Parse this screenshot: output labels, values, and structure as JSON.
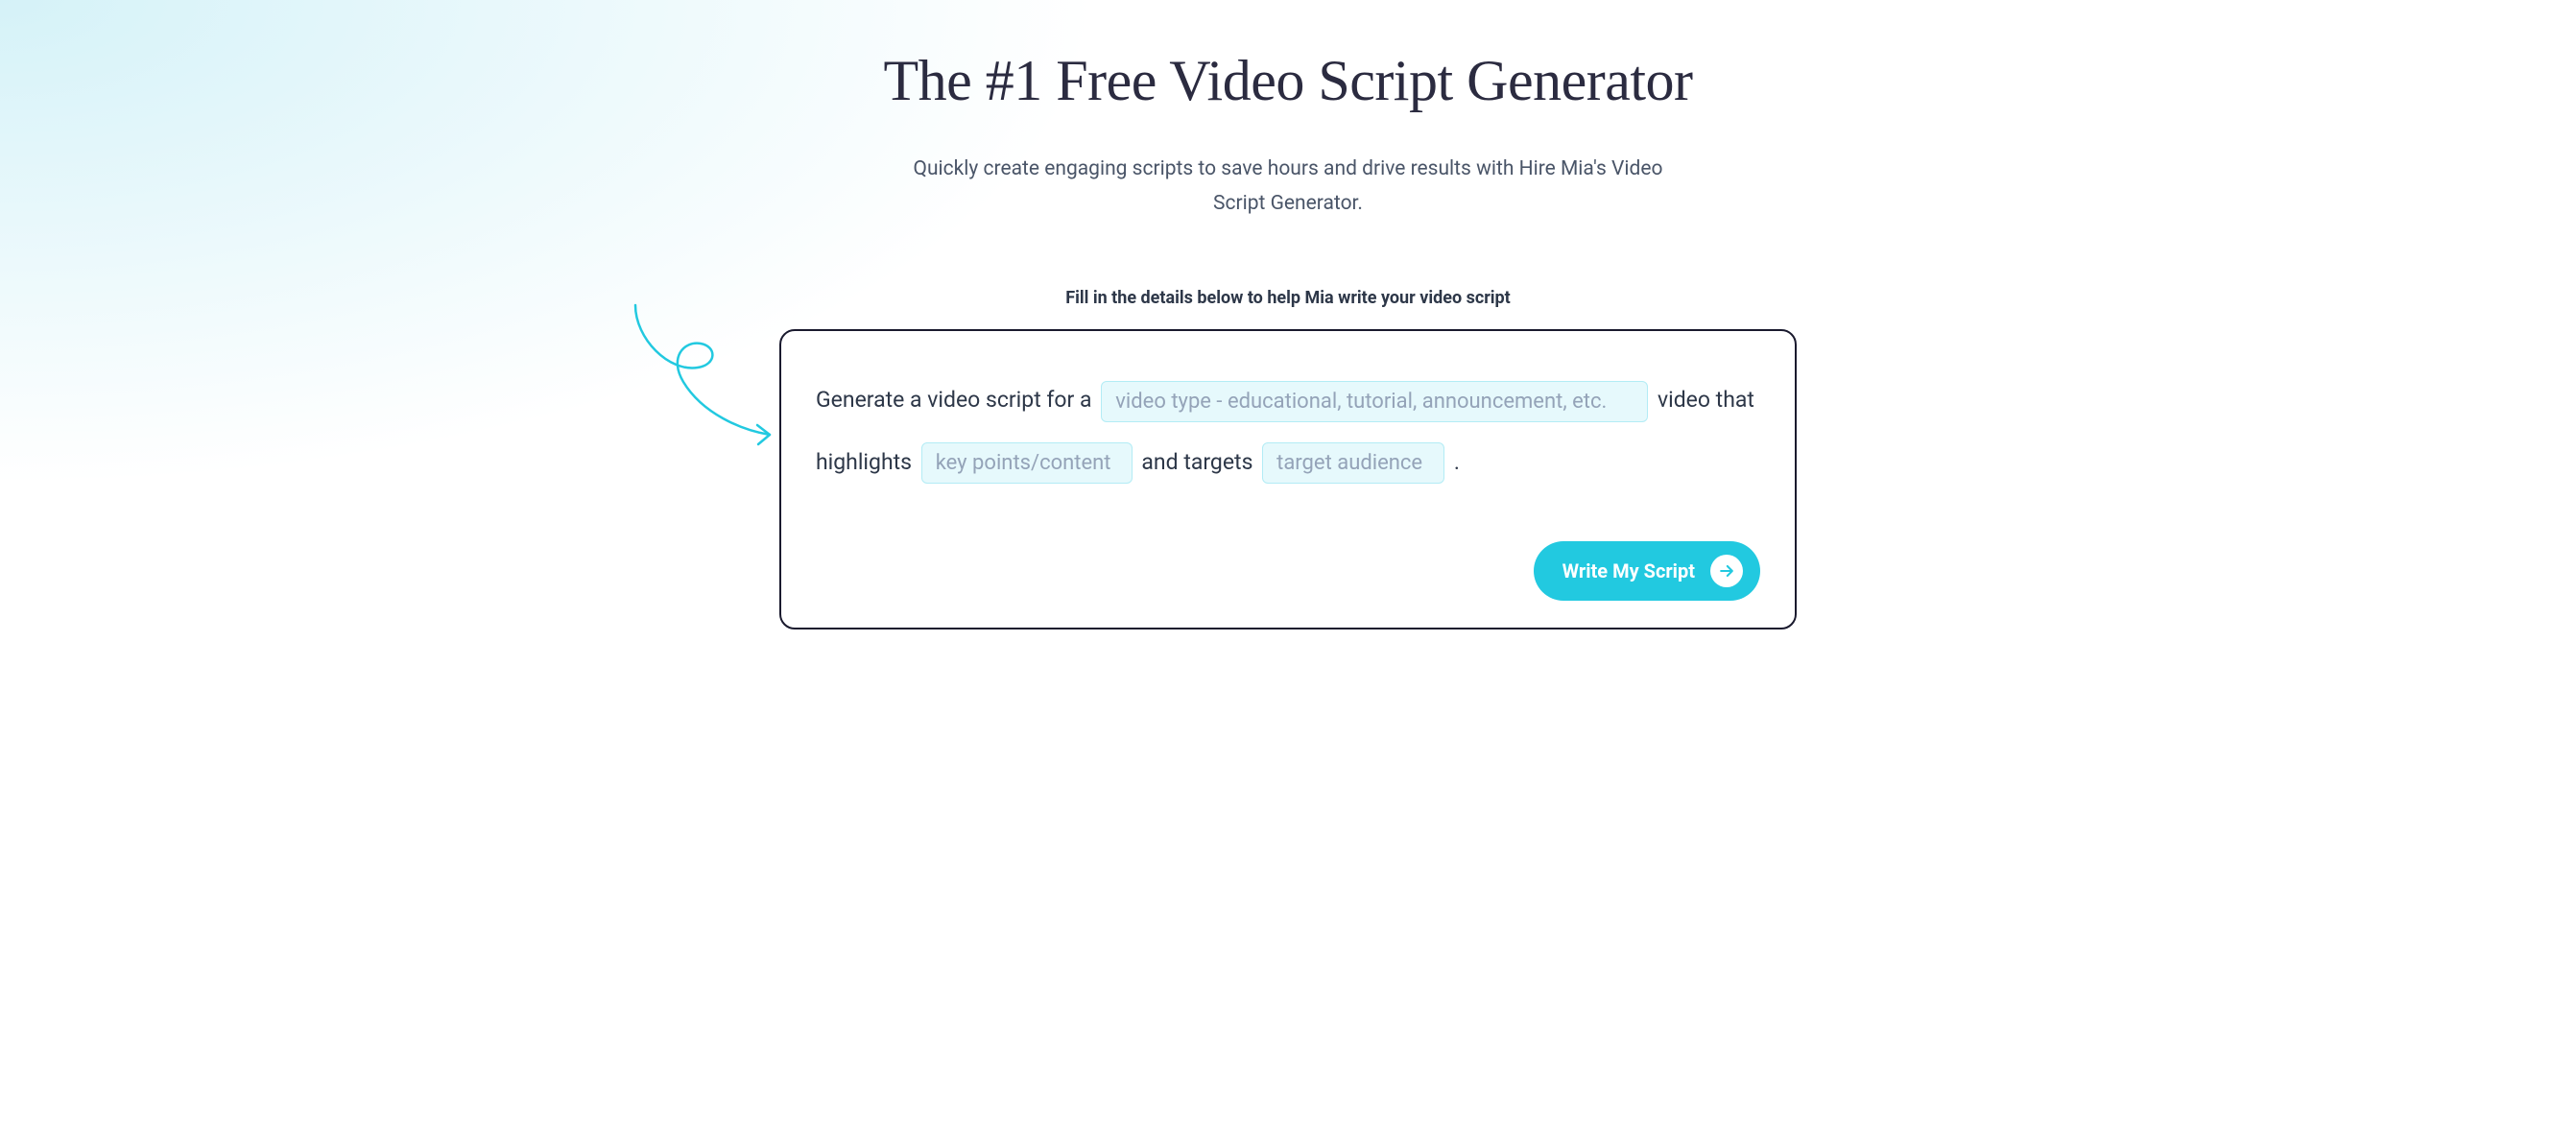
{
  "header": {
    "title": "The #1 Free Video Script Generator",
    "subtitle": "Quickly create engaging scripts to save hours and drive results with Hire Mia's Video Script Generator."
  },
  "form": {
    "instruction": "Fill in the details below to help Mia write your video script",
    "prompt_parts": {
      "prefix": "Generate a video script for a ",
      "after_video_type": " video that highlights ",
      "after_key_points": " and targets ",
      "suffix": " ."
    },
    "inputs": {
      "video_type": {
        "placeholder": "video type - educational, tutorial, announcement, etc.",
        "value": ""
      },
      "key_points": {
        "placeholder": "key points/content",
        "value": ""
      },
      "audience": {
        "placeholder": "target audience",
        "value": ""
      }
    },
    "submit_label": "Write My Script"
  },
  "colors": {
    "accent": "#22c9e0",
    "card_border": "#1a1a2e",
    "input_bg": "#e6f9fc",
    "input_border": "#b3ecf5"
  }
}
